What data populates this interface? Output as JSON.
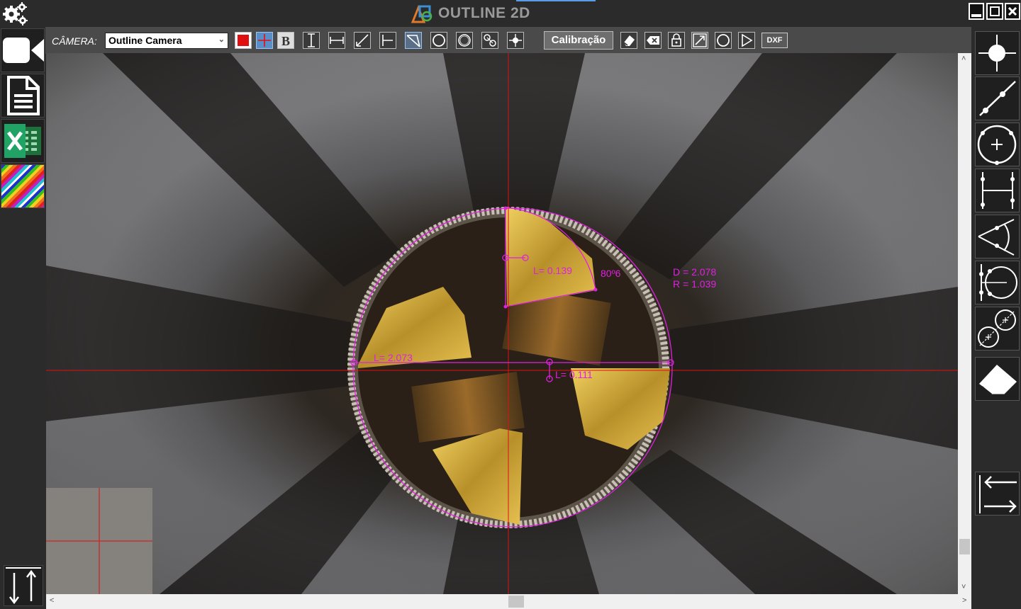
{
  "app": {
    "title": "OUTLINE 2D"
  },
  "toolbar": {
    "camera_label": "CÂMERA:",
    "camera_value": "Outline Camera",
    "calibration_label": "Calibração",
    "dxf_label": "DXF"
  },
  "measurements": {
    "length_top": "L= 0.139",
    "angle": "80º6",
    "diameter": "D = 2.078",
    "radius": "R = 1.039",
    "length_diameter": "L= 2.073",
    "length_small": "L= 0.111"
  },
  "colors": {
    "measure": "#e020e0",
    "crosshair": "#e01010",
    "toolbar": "#4a4a4a",
    "background": "#2b2b2b"
  },
  "icons": {
    "left": [
      "gear-icon",
      "camera-icon",
      "document-icon",
      "excel-icon",
      "color-palette-icon",
      "vertical-arrows-icon"
    ],
    "right": [
      "point-tool-icon",
      "line-tool-icon",
      "circle-tool-icon",
      "distance-tool-icon",
      "angle-tool-icon",
      "circle-center-tool-icon",
      "two-circle-tool-icon",
      "eraser-icon",
      "horizontal-arrows-icon"
    ]
  }
}
